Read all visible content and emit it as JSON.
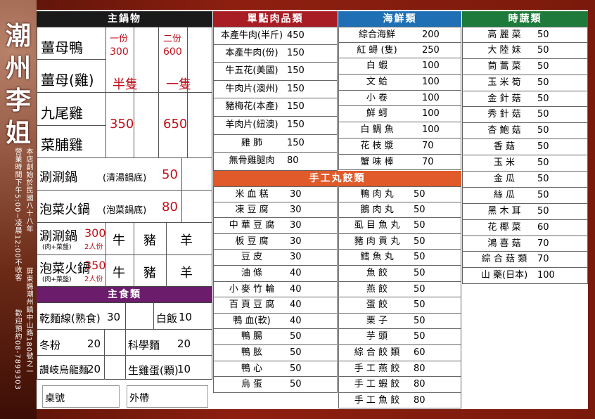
{
  "brand": {
    "chars": [
      "潮",
      "州",
      "李",
      "姐"
    ]
  },
  "side_notes": {
    "founded": "本店創始於民國八十八年",
    "hours": "營業時間下午5:00~凌晨12:00不收客",
    "address": "屏東縣潮州鎮中山路180號之一",
    "reserve": "歡迎預約08-7899303"
  },
  "hotpot": {
    "header": "主鍋物",
    "cols": {
      "one": "一份",
      "two": "二份"
    },
    "duck": {
      "name": "薑母鴨",
      "p1": "300",
      "p2": "600"
    },
    "chicken": {
      "name": "薑母(雞)"
    },
    "nine": {
      "name": "九尾雞"
    },
    "radish": {
      "name": "菜脯雞"
    },
    "half": "半隻",
    "whole": "一隻",
    "half_price": "350",
    "whole_price": "650",
    "shabu": {
      "name": "涮涮鍋",
      "note": "(清湯鍋底)",
      "price": "50"
    },
    "kimchi": {
      "name": "泡菜火鍋",
      "note": "(泡菜鍋底)",
      "price": "80"
    },
    "shabu2": {
      "name": "涮涮鍋",
      "sub": "(肉+菜盤)",
      "price": "300",
      "people": "2人份"
    },
    "kimchi2": {
      "name": "泡菜火鍋",
      "sub": "(肉+菜盤)",
      "price": "350",
      "people": "2人份"
    },
    "meats": [
      "牛",
      "豬",
      "羊"
    ]
  },
  "staple": {
    "header": "主食類",
    "items": [
      {
        "name": "乾麵線(熟食)",
        "price": "30"
      },
      {
        "name": "白飯",
        "price": "10"
      },
      {
        "name": "冬粉",
        "price": "20"
      },
      {
        "name": "科學麵",
        "price": "20"
      },
      {
        "name": "讚岐烏龍麵",
        "price": "20"
      },
      {
        "name": "生雞蛋(顆)",
        "price": "10"
      }
    ],
    "table_no": "桌號",
    "takeout": "外帶"
  },
  "meat": {
    "header": "單點肉品類",
    "items": [
      {
        "name": "本產牛肉(半斤)",
        "price": "450"
      },
      {
        "name": "本產牛肉(份)",
        "price": "150"
      },
      {
        "name": "牛五花(美國)",
        "price": "150"
      },
      {
        "name": "牛肉片(澳州)",
        "price": "150"
      },
      {
        "name": "豬梅花(本產)",
        "price": "150"
      },
      {
        "name": "羊肉片(紐澳)",
        "price": "150"
      },
      {
        "name": "雞 肺",
        "price": "150"
      },
      {
        "name": "無骨雞腿肉",
        "price": "80"
      }
    ]
  },
  "seafood": {
    "header": "海鮮類",
    "items": [
      {
        "name": "綜合海鮮",
        "price": "200"
      },
      {
        "name": "紅 蟳 (隻)",
        "price": "250"
      },
      {
        "name": "白 蝦",
        "price": "100"
      },
      {
        "name": "文 蛤",
        "price": "100"
      },
      {
        "name": "小 卷",
        "price": "100"
      },
      {
        "name": "鮮 蚵",
        "price": "100"
      },
      {
        "name": "白 鯛 魚",
        "price": "100"
      },
      {
        "name": "花 枝 漿",
        "price": "70"
      },
      {
        "name": "蟹 味 棒",
        "price": "70"
      }
    ]
  },
  "balls": {
    "header": "手工丸餃類",
    "left": [
      {
        "name": "米 血 糕",
        "price": "30"
      },
      {
        "name": "凍 豆 腐",
        "price": "30"
      },
      {
        "name": "中 華 豆 腐",
        "price": "30"
      },
      {
        "name": "板 豆 腐",
        "price": "30"
      },
      {
        "name": "豆 皮",
        "price": "30"
      },
      {
        "name": "油 條",
        "price": "40"
      },
      {
        "name": "小 麥 竹 輪",
        "price": "40"
      },
      {
        "name": "百 頁 豆 腐",
        "price": "40"
      },
      {
        "name": "鴨 血(軟)",
        "price": "40"
      },
      {
        "name": "鴨 腸",
        "price": "50"
      },
      {
        "name": "鴨 胘",
        "price": "50"
      },
      {
        "name": "鴨 心",
        "price": "50"
      },
      {
        "name": "烏 蛋",
        "price": "50"
      }
    ],
    "right": [
      {
        "name": "鴨 肉 丸",
        "price": "50"
      },
      {
        "name": "鵝 肉 丸",
        "price": "50"
      },
      {
        "name": "虱 目 魚 丸",
        "price": "50"
      },
      {
        "name": "豬 肉 貢 丸",
        "price": "50"
      },
      {
        "name": "鱈 魚 丸",
        "price": "50"
      },
      {
        "name": "魚 餃",
        "price": "50"
      },
      {
        "name": "燕 餃",
        "price": "50"
      },
      {
        "name": "蛋 餃",
        "price": "50"
      },
      {
        "name": "栗 子",
        "price": "50"
      },
      {
        "name": "芋 頭",
        "price": "50"
      },
      {
        "name": "綜 合 餃 類",
        "price": "60"
      },
      {
        "name": "手 工 燕 餃",
        "price": "80"
      },
      {
        "name": "手 工 蝦 餃",
        "price": "80"
      },
      {
        "name": "手 工 魚 餃",
        "price": "80"
      }
    ]
  },
  "veg": {
    "header": "時蔬類",
    "items": [
      {
        "name": "高 麗 菜",
        "price": "50"
      },
      {
        "name": "大 陸 妹",
        "price": "50"
      },
      {
        "name": "茼 蒿 菜",
        "price": "50"
      },
      {
        "name": "玉 米 筍",
        "price": "50"
      },
      {
        "name": "金 針 菇",
        "price": "50"
      },
      {
        "name": "秀 針 菇",
        "price": "50"
      },
      {
        "name": "杏 鮑 菇",
        "price": "50"
      },
      {
        "name": "香 菇",
        "price": "50"
      },
      {
        "name": "玉 米",
        "price": "50"
      },
      {
        "name": "金 瓜",
        "price": "50"
      },
      {
        "name": "絲 瓜",
        "price": "50"
      },
      {
        "name": "黑 木 耳",
        "price": "50"
      },
      {
        "name": "花 椰 菜",
        "price": "60"
      },
      {
        "name": "鴻 喜 菇",
        "price": "70"
      },
      {
        "name": "綜 合 菇 類",
        "price": "70"
      },
      {
        "name": "山 藥(日本)",
        "price": "100"
      }
    ]
  },
  "colors": {
    "black": "#1a1a1a",
    "red": "#a81c24",
    "blue": "#1f6fb5",
    "green": "#1d7a3a",
    "orange": "#e05a2a",
    "purple": "#6b1d6b",
    "price_red": "#c0101a"
  }
}
